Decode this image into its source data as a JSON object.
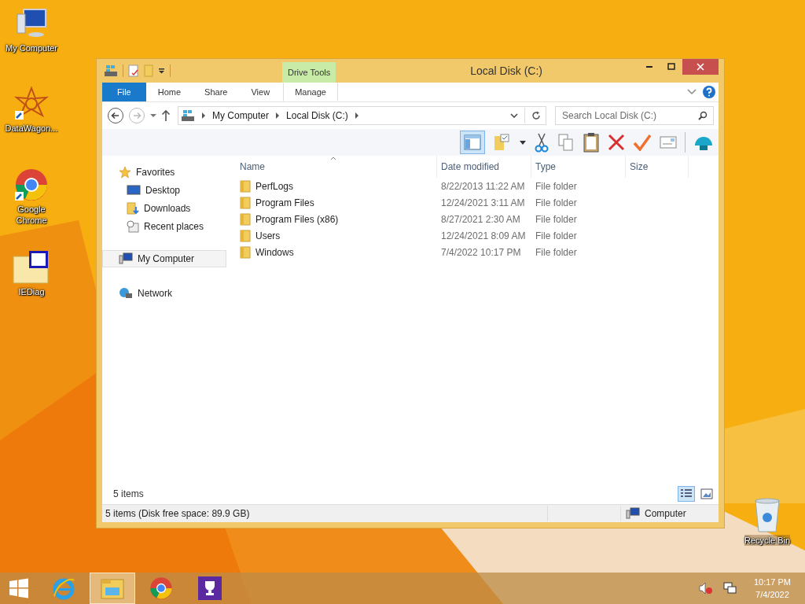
{
  "desktop_icons": [
    {
      "label": "My Computer",
      "kind": "computer"
    },
    {
      "label": "DataWagon...",
      "kind": "star"
    },
    {
      "label": "Google Chrome",
      "kind": "chrome"
    },
    {
      "label": "IEDiag",
      "kind": "ca"
    }
  ],
  "recycle_bin": {
    "label": "Recycle Bin"
  },
  "window": {
    "title": "Local Disk (C:)",
    "context_tab_group": "Drive Tools"
  },
  "ribbon_tabs": [
    {
      "label": "File",
      "kind": "file",
      "selected": false
    },
    {
      "label": "Home",
      "kind": "normal",
      "selected": false
    },
    {
      "label": "Share",
      "kind": "normal",
      "selected": false
    },
    {
      "label": "View",
      "kind": "normal",
      "selected": false
    },
    {
      "label": "Manage",
      "kind": "contextual",
      "selected": false
    }
  ],
  "address": {
    "crumbs": [
      "My Computer",
      "Local Disk (C:)"
    ]
  },
  "search": {
    "placeholder": "Search Local Disk (C:)"
  },
  "nav": [
    {
      "label": "Favorites",
      "kind": "star",
      "selected": false,
      "children": [
        {
          "label": "Desktop",
          "kind": "desktop",
          "selected": false
        },
        {
          "label": "Downloads",
          "kind": "downloads",
          "selected": false
        },
        {
          "label": "Recent places",
          "kind": "recent",
          "selected": false
        }
      ]
    },
    {
      "label": "My Computer",
      "kind": "computer",
      "selected": true
    },
    {
      "label": "Network",
      "kind": "network",
      "selected": false
    }
  ],
  "table": {
    "columns": [
      "Name",
      "Date modified",
      "Type",
      "Size"
    ],
    "rows": [
      {
        "name": "PerfLogs",
        "date": "8/22/2013 11:22 AM",
        "type": "File folder"
      },
      {
        "name": "Program Files",
        "date": "12/24/2021 3:11 AM",
        "type": "File folder"
      },
      {
        "name": "Program Files (x86)",
        "date": "8/27/2021 2:30 AM",
        "type": "File folder"
      },
      {
        "name": "Users",
        "date": "12/24/2021 8:09 AM",
        "type": "File folder"
      },
      {
        "name": "Windows",
        "date": "7/4/2022 10:17 PM",
        "type": "File folder"
      }
    ]
  },
  "item_count": "5 items",
  "view_buttons": [
    {
      "kind": "details",
      "selected": true
    },
    {
      "kind": "large",
      "selected": false
    }
  ],
  "status_bar": {
    "text": "5 items (Disk free space: 89.9 GB)",
    "location": "Computer"
  },
  "taskbar": {
    "apps": [
      {
        "kind": "ie",
        "selected": false
      },
      {
        "kind": "explorer",
        "selected": true
      },
      {
        "kind": "chrome",
        "selected": false
      },
      {
        "kind": "trophy",
        "selected": false
      }
    ],
    "time": "10:17 PM",
    "date": "7/4/2022"
  }
}
